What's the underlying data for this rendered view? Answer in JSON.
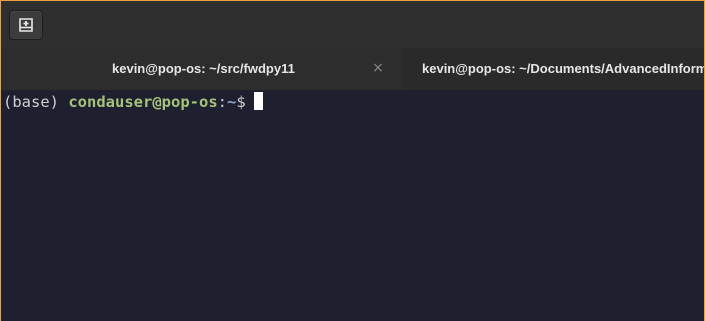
{
  "window": {
    "tabs": [
      {
        "label": "kevin@pop-os: ~/src/fwdpy11",
        "close": "×"
      },
      {
        "label": "kevin@pop-os: ~/Documents/AdvancedInform"
      }
    ]
  },
  "terminal": {
    "prompt": {
      "env": "(base)",
      "userhost": "condauser@pop-os",
      "separator": ":",
      "cwd": "~",
      "symbol": "$"
    }
  },
  "colors": {
    "window_border": "#f0a040",
    "terminal_bg": "#1e2030",
    "userhost": "#a6c27a",
    "cwd": "#8fa8c8"
  },
  "icons": {
    "new_tab": "new-tab-icon",
    "close": "close-icon"
  }
}
